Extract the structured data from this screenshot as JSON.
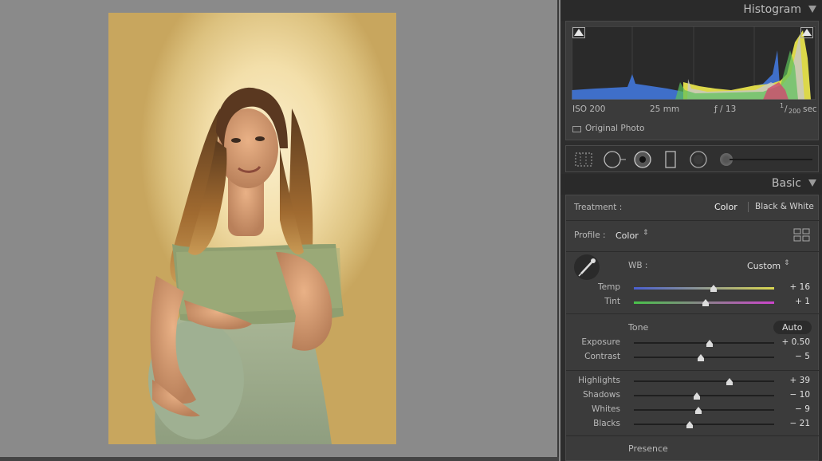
{
  "histogram": {
    "title": "Histogram",
    "iso": "ISO 200",
    "focal": "25 mm",
    "aperture": "ƒ / 13",
    "shutter_num": "1",
    "shutter_den": "200",
    "shutter_unit": "sec",
    "original_photo": "Original Photo"
  },
  "basic": {
    "title": "Basic",
    "treatment_label": "Treatment :",
    "treatment_color": "Color",
    "treatment_bw": "Black & White",
    "profile_label": "Profile :",
    "profile_value": "Color",
    "wb_label": "WB :",
    "wb_value": "Custom",
    "tone_label": "Tone",
    "auto_label": "Auto",
    "presence_label": "Presence"
  },
  "sliders": {
    "temp": {
      "label": "Temp",
      "value": "+ 16",
      "pos": 0.57
    },
    "tint": {
      "label": "Tint",
      "value": "+ 1",
      "pos": 0.51
    },
    "exposure": {
      "label": "Exposure",
      "value": "+ 0.50",
      "pos": 0.54
    },
    "contrast": {
      "label": "Contrast",
      "value": "− 5",
      "pos": 0.48
    },
    "highlights": {
      "label": "Highlights",
      "value": "+ 39",
      "pos": 0.68
    },
    "shadows": {
      "label": "Shadows",
      "value": "− 10",
      "pos": 0.45
    },
    "whites": {
      "label": "Whites",
      "value": "− 9",
      "pos": 0.46
    },
    "blacks": {
      "label": "Blacks",
      "value": "− 21",
      "pos": 0.4
    }
  },
  "colors": {
    "accent_highlight": "#e6e6e6",
    "temp_gradient_start": "#4a5fd0",
    "temp_gradient_end": "#d9d650",
    "tint_gradient_start": "#49c24a",
    "tint_gradient_end": "#cc44cc"
  },
  "icons": {
    "crop": "crop-overlay-icon",
    "spot": "spot-removal-icon",
    "redeye": "red-eye-icon",
    "graduated": "graduated-filter-icon",
    "radial": "radial-filter-icon",
    "brush": "adjustment-brush-icon",
    "eyedropper": "wb-eyedropper-icon",
    "grid": "profile-browser-icon"
  }
}
